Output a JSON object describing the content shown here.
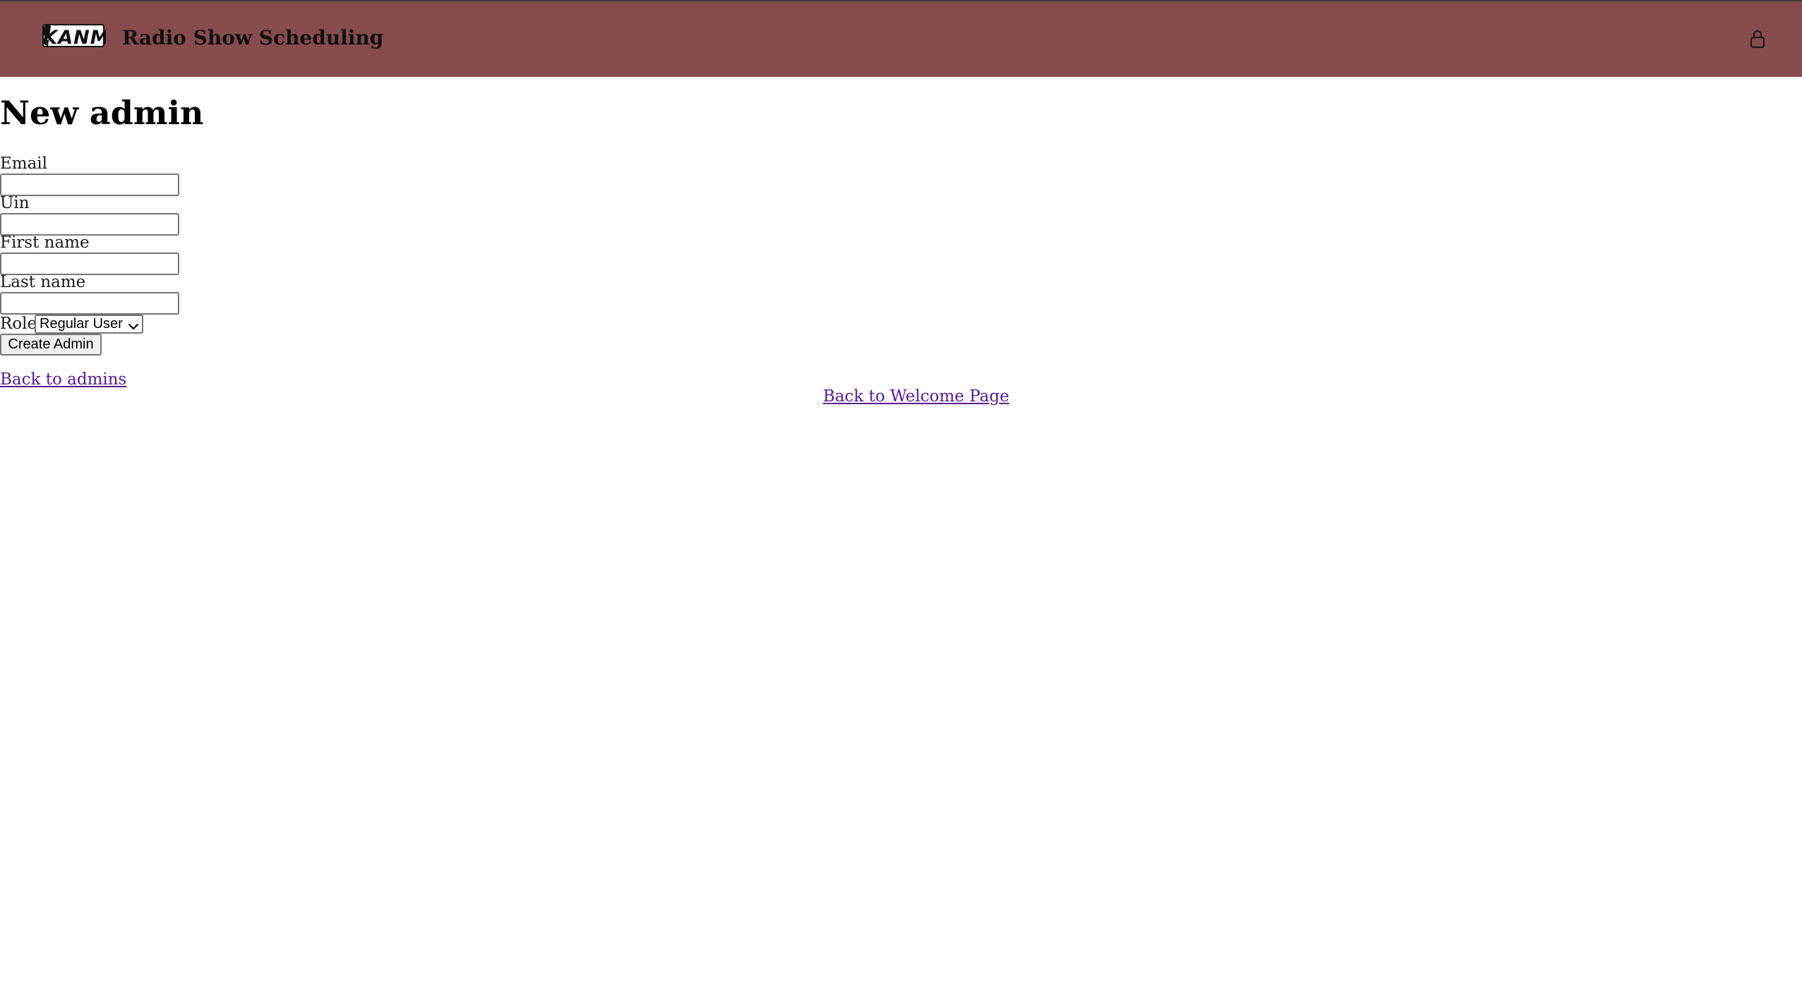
{
  "header": {
    "logo_text": "KANM",
    "app_title": "Radio Show Scheduling",
    "background_color": "#874c4f",
    "user_icon": "user-icon"
  },
  "page": {
    "title": "New admin"
  },
  "form": {
    "fields": [
      {
        "label": "Email",
        "value": ""
      },
      {
        "label": "Uin",
        "value": ""
      },
      {
        "label": "First name",
        "value": ""
      },
      {
        "label": "Last name",
        "value": ""
      }
    ],
    "role": {
      "label": "Role",
      "selected": "Regular User"
    },
    "submit_label": "Create Admin"
  },
  "links": {
    "back_to_admins": "Back to admins",
    "back_to_welcome": "Back to Welcome Page",
    "color": "#551a8b"
  }
}
